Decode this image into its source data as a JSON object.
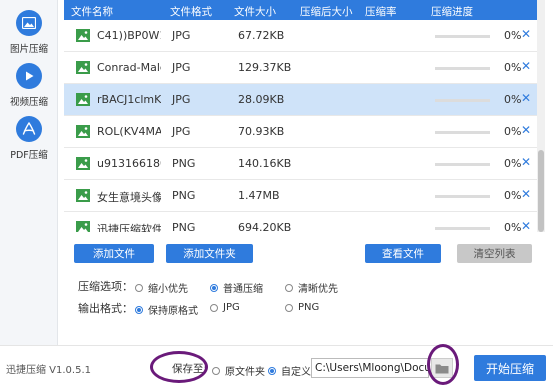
{
  "sidebar": {
    "items": [
      {
        "label": "图片压缩",
        "icon": "image-icon"
      },
      {
        "label": "视频压缩",
        "icon": "play-icon"
      },
      {
        "label": "PDF压缩",
        "icon": "pdf-icon"
      }
    ]
  },
  "table": {
    "headers": [
      "文件名称",
      "文件格式",
      "文件大小",
      "压缩后大小",
      "压缩率",
      "压缩进度"
    ],
    "rows": [
      {
        "name": "C41))BP0W1Y...",
        "format": "JPG",
        "size": "67.72KB",
        "progress": "0%"
      },
      {
        "name": "Conrad-Mald...",
        "format": "JPG",
        "size": "129.37KB",
        "progress": "0%"
      },
      {
        "name": "rBACJ1clmKji...",
        "format": "JPG",
        "size": "28.09KB",
        "progress": "0%"
      },
      {
        "name": "ROL(KV4MA...",
        "format": "JPG",
        "size": "70.93KB",
        "progress": "0%"
      },
      {
        "name": "u9131661806...",
        "format": "PNG",
        "size": "140.16KB",
        "progress": "0%"
      },
      {
        "name": "女生意境头像_...",
        "format": "PNG",
        "size": "1.47MB",
        "progress": "0%"
      },
      {
        "name": "迅捷压缩软件...",
        "format": "PNG",
        "size": "694.20KB",
        "progress": "0%"
      }
    ],
    "selected_index": 2
  },
  "actions": {
    "add_file": "添加文件",
    "add_folder": "添加文件夹",
    "view_files": "查看文件",
    "clear_list": "清空列表"
  },
  "options": {
    "compress_label": "压缩选项：",
    "compress": [
      {
        "label": "缩小优先",
        "checked": false
      },
      {
        "label": "普通压缩",
        "checked": true
      },
      {
        "label": "清晰优先",
        "checked": false
      }
    ],
    "format_label": "输出格式：",
    "format": [
      {
        "label": "保持原格式",
        "checked": true
      },
      {
        "label": "JPG",
        "checked": false
      },
      {
        "label": "PNG",
        "checked": false
      }
    ]
  },
  "footer": {
    "version": "迅捷压缩 V1.0.5.1",
    "save_label": "保存至:",
    "original_folder": "原文件夹",
    "custom": "自定义",
    "path": "C:\\Users\\Mloong\\Documents",
    "start": "开始压缩"
  },
  "colors": {
    "accent": "#2f7bdd",
    "annotation": "#6a1a7a"
  }
}
